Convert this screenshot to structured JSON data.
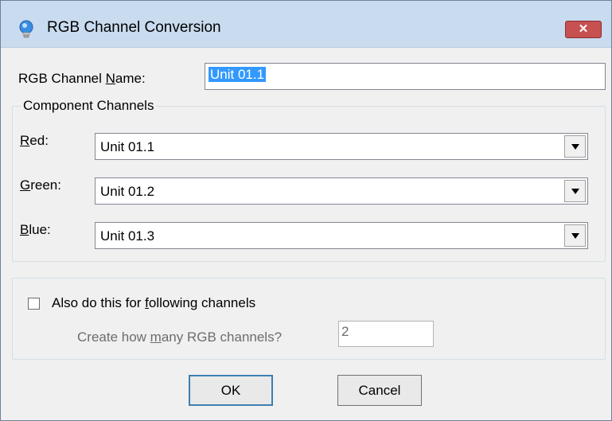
{
  "window": {
    "title": "RGB Channel Conversion",
    "close_label": "✕"
  },
  "name_field": {
    "label_prefix": "RGB Channel ",
    "label_mnemonic": "N",
    "label_suffix": "ame:",
    "value": "Unit 01.1"
  },
  "component_group": {
    "title": "Component Channels"
  },
  "channels": [
    {
      "label_mnemonic": "R",
      "label_rest": "ed:",
      "value": "Unit 01.1"
    },
    {
      "label_mnemonic": "G",
      "label_rest": "reen:",
      "value": "Unit 01.2"
    },
    {
      "label_mnemonic": "B",
      "label_rest": "lue:",
      "value": "Unit 01.3"
    }
  ],
  "repeat": {
    "checkbox_prefix": "Also do this for ",
    "checkbox_mnemonic": "f",
    "checkbox_suffix": "ollowing channels",
    "checked": false,
    "count_prefix": "Create how ",
    "count_mnemonic": "m",
    "count_suffix": "any RGB channels?",
    "count_value": "2"
  },
  "buttons": {
    "ok": "OK",
    "cancel": "Cancel"
  }
}
